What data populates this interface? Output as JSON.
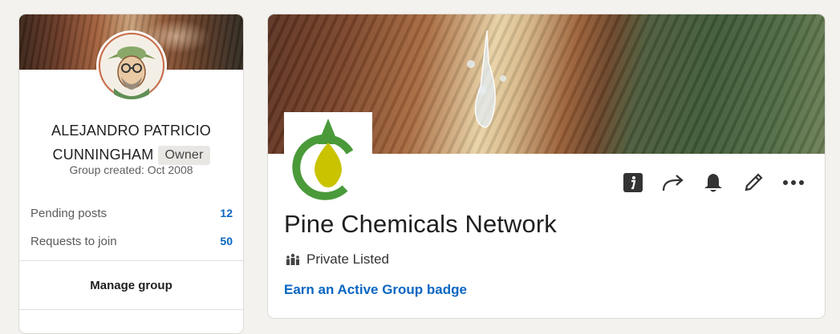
{
  "sidebar": {
    "owner": {
      "name_line1": "ALEJANDRO PATRICIO",
      "name_line2": "CUNNINGHAM",
      "role": "Owner",
      "created": "Group created: Oct 2008"
    },
    "stats": [
      {
        "label": "Pending posts",
        "value": "12"
      },
      {
        "label": "Requests to join",
        "value": "50"
      }
    ],
    "manage_label": "Manage group"
  },
  "group": {
    "title": "Pine Chemicals Network",
    "privacy": "Private Listed",
    "badge_link": "Earn an Active Group badge",
    "actions": [
      "info-icon",
      "share-icon",
      "bell-icon",
      "edit-icon",
      "more-icon"
    ]
  },
  "colors": {
    "accent": "#0a66c2",
    "logo_green": "#4a9a3a",
    "logo_drop": "#c9c300"
  }
}
